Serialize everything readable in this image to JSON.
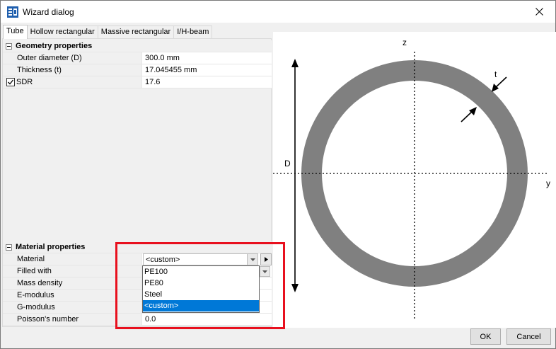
{
  "window": {
    "title": "Wizard dialog"
  },
  "tabs": [
    {
      "label": "Tube",
      "active": true
    },
    {
      "label": "Hollow rectangular",
      "active": false
    },
    {
      "label": "Massive rectangular",
      "active": false
    },
    {
      "label": "I/H-beam",
      "active": false
    }
  ],
  "geometry": {
    "header": "Geometry properties",
    "rows": [
      {
        "label": "Outer diameter (D)",
        "value": "300.0 mm"
      },
      {
        "label": "Thickness (t)",
        "value": "17.045455 mm"
      },
      {
        "label": "SDR",
        "value": "17.6"
      }
    ]
  },
  "material": {
    "header": "Material properties",
    "rows": [
      {
        "label": "Material",
        "value": "<custom>"
      },
      {
        "label": "Filled with",
        "value": ""
      },
      {
        "label": "Mass density",
        "value": ""
      },
      {
        "label": "E-modulus",
        "value": ""
      },
      {
        "label": "G-modulus",
        "value": ""
      },
      {
        "label": "Poisson's number",
        "value": "0.0"
      }
    ],
    "dropdown_options": [
      "PE100",
      "PE80",
      "Steel",
      "<custom>"
    ],
    "dropdown_selected": "<custom>"
  },
  "drawing": {
    "axis_z": "z",
    "axis_y": "y",
    "dim_d": "D",
    "dim_t": "t"
  },
  "buttons": {
    "ok": "OK",
    "cancel": "Cancel"
  },
  "colors": {
    "tube": "#808080",
    "highlight": "#e8101e",
    "selection": "#0078d7"
  }
}
